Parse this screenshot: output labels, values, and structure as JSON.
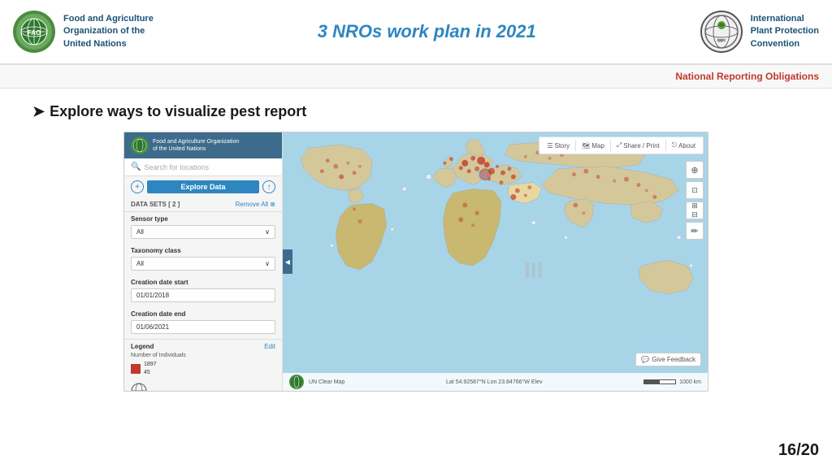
{
  "header": {
    "fao_logo_text": "FAO",
    "fao_org_name": "Food and Agriculture\nOrganization of the\nUnited Nations",
    "title": "3 NROs work plan in 2021",
    "ippc_logo_text": "ippc",
    "ippc_org_name": "International\nPlant Protection\nConvention"
  },
  "sub_header": {
    "text": "National Reporting Obligations"
  },
  "slide": {
    "section_arrow": "➤",
    "section_title": "Explore ways to visualize pest report"
  },
  "map_panel": {
    "org_text": "Food and Agriculture Organization\nof the United Nations",
    "search_placeholder": "Search for locations",
    "explore_btn": "Explore Data",
    "datasets_label": "DATA SETS  [ 2 ]",
    "remove_all": "Remove All ⊗",
    "sensor_label": "Sensor type",
    "sensor_value": "All",
    "taxonomy_label": "Taxonomy class",
    "taxonomy_value": "All",
    "creation_start_label": "Creation date start",
    "creation_start_value": "01/01/2018",
    "creation_end_label": "Creation date end",
    "creation_end_value": "01/06/2021",
    "legend_label": "Legend",
    "legend_edit": "Edit",
    "legend_description": "Number of Individuals",
    "legend_val1": "1897",
    "legend_val2": "45"
  },
  "map_toolbar": {
    "story_btn": "Story",
    "map_btn": "Map",
    "share_btn": "Share / Print",
    "about_btn": "About"
  },
  "map_footer": {
    "clear_map": "UN Clear Map",
    "coords": "Lat  54.92587°N   Lon  23.84766°W   Elev",
    "scale": "1000 km"
  },
  "map_feedback": {
    "text": "Give Feedback"
  },
  "slide_counter": {
    "current": "16",
    "total": "20",
    "separator": "/"
  }
}
